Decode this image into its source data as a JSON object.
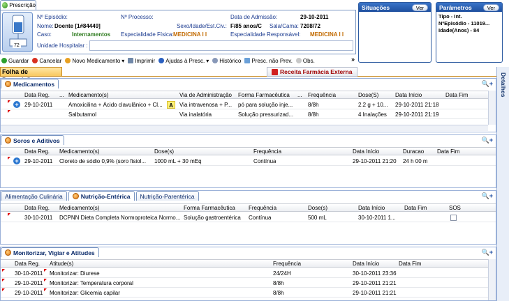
{
  "window_tab": "Prescrição",
  "patient": {
    "bed_number": "72",
    "episodio_label": "Nº Episódio:",
    "episodio_value": "",
    "processo_label": "Nº Processo:",
    "processo_value": "",
    "admissao_label": "Data de Admissão:",
    "admissao_value": "29-10-2011",
    "nome_label": "Nome:",
    "nome_value": "Doente [1#84449]",
    "sexo_label": "Sexo/Idade/Est.Civ.:",
    "sexo_value": "F/85 anos/C",
    "sala_label": "Sala/Cama:",
    "sala_value": "7208/72",
    "caso_label": "Caso:",
    "caso_value": "Internamentos",
    "esp_fisica_label": "Especialidade Física:",
    "esp_fisica_value": "MEDICINA I I",
    "esp_resp_label": "Especialidade Responsável:",
    "esp_resp_value": "MEDICINA I I",
    "unidade_label": "Unidade Hospitalar :",
    "unidade_value": ""
  },
  "situacoes": {
    "title": "Situações",
    "ver": "Ver"
  },
  "parametros": {
    "title": "Parâmetros",
    "ver": "Ver",
    "lines": [
      "Tipo - Int.",
      "NºEpisódio - 11019...",
      "Idade(Anos) - 84"
    ]
  },
  "toolbar": {
    "guardar": "Guardar",
    "cancelar": "Cancelar",
    "novo_medicamento": "Novo Medicamento",
    "imprimir": "Imprimir",
    "ajudas": "Ajudas à Presc.",
    "historico": "Histórico",
    "presc_nao_prev": "Presc. não Prev.",
    "obs": "Obs.",
    "more": "»"
  },
  "tabs": {
    "folha": "Folha de Prescrição",
    "receita": "Receita Farmácia Externa",
    "detalhes": "Detalhes"
  },
  "medicamentos": {
    "title": "Medicamentos",
    "columns": [
      "Data Reg.",
      "...",
      "Medicamento(s)",
      "Via de Administração",
      "Forma Farmacêutica",
      "...",
      "Frequência",
      "Dose(S)",
      "Data Início",
      "Data Fim"
    ],
    "rows": [
      {
        "data": "29-10-2011",
        "med": "Amoxicilina + Ácido clavulânico + Cl...",
        "badge": "A",
        "via": "Via intravenosa + P...",
        "forma": "pó para solução inje...",
        "freq": "8/8h",
        "dose": "2.2 g + 10...",
        "inicio": "29-10-2011 21:18",
        "fim": ""
      },
      {
        "data": "",
        "med": "Salbutamol",
        "badge": "",
        "via": "Via inalatória",
        "forma": "Solução pressurizad...",
        "freq": "8/8h",
        "dose": "4 Inalações",
        "inicio": "29-10-2011 21:19",
        "fim": ""
      }
    ]
  },
  "soros": {
    "title": "Soros e Aditivos",
    "columns": [
      "Data Reg.",
      "Medicamento(s)",
      "Dose(s)",
      "Frequência",
      "Data Início",
      "Duracao",
      "Data Fim"
    ],
    "rows": [
      {
        "data": "29-10-2011",
        "med": "Cloreto de sódio 0,9% (soro fisiol...",
        "dose": "1000 mL + 30 mEq",
        "freq": "Contínua",
        "inicio": "29-10-2011 21:20",
        "duracao": "24 h 00 m",
        "fim": ""
      }
    ]
  },
  "nutricao": {
    "tabs": [
      "Alimentação Culinária",
      "Nutrição-Entérica",
      "Nutrição-Parentérica"
    ],
    "columns": [
      "Data Reg.",
      "Medicamento(s)",
      "Forma Farmacêutica",
      "Frequência",
      "Dose(s)",
      "Data Início",
      "Data Fim",
      "SOS"
    ],
    "rows": [
      {
        "data": "30-10-2011",
        "med": "DCPNN Dieta Completa Normoproteica Normo...",
        "forma": "Solução gastroentérica",
        "freq": "Contínua",
        "dose": "500 mL",
        "inicio": "30-10-2011 1...",
        "fim": ""
      }
    ]
  },
  "monitorizar": {
    "title": "Monitorizar, Vigiar e Atitudes",
    "columns": [
      "Data Reg.",
      "Atitude(s)",
      "Frequência",
      "Data Início",
      "Data Fim"
    ],
    "rows": [
      {
        "data": "30-10-2011",
        "atitude": "Monitorizar: Diurese",
        "freq": "24/24H",
        "inicio": "30-10-2011 23:36",
        "fim": ""
      },
      {
        "data": "29-10-2011",
        "atitude": "Monitorizar: Temperatura corporal",
        "freq": "8/8h",
        "inicio": "29-10-2011 21:21",
        "fim": ""
      },
      {
        "data": "29-10-2011",
        "atitude": "Monitorizar: Glicemia capilar",
        "freq": "8/8h",
        "inicio": "29-10-2011 21:21",
        "fim": ""
      }
    ]
  },
  "colors": {
    "accent": "#1e4f9e",
    "orange": "#c26a00",
    "green": "#2c7a1c",
    "receita_red": "#a00000"
  }
}
